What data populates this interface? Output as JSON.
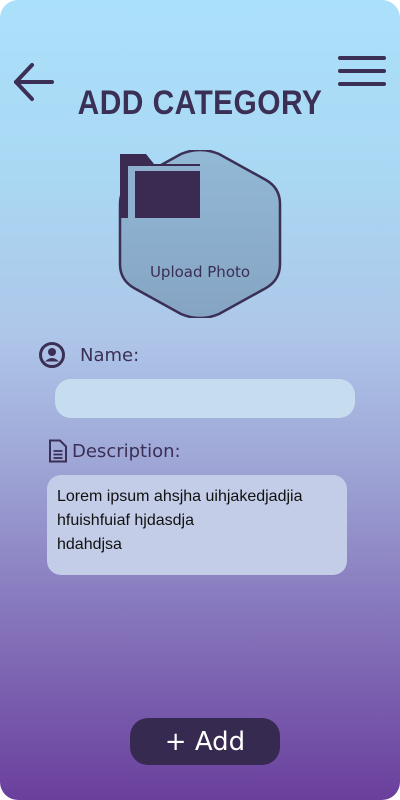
{
  "header": {
    "title": "ADD CATEGORY",
    "back_icon": "arrow-left-icon",
    "menu_icon": "hamburger-menu-icon"
  },
  "upload": {
    "label": "Upload Photo",
    "icon": "folder-icon"
  },
  "form": {
    "name": {
      "label": "Name:",
      "icon": "user-circle-icon",
      "value": "",
      "placeholder": ""
    },
    "description": {
      "label": "Description:",
      "icon": "document-icon",
      "value": "Lorem ipsum ahsjha uihjakedjadjia\nhfuishfuiaf hjdasdja\nhdahdjsa"
    }
  },
  "actions": {
    "add_label": "+ Add"
  },
  "colors": {
    "primary_dark": "#362a50",
    "text_dark": "#3b2f55",
    "gradient_top": "#abe0fb",
    "gradient_bottom": "#6a3f9d",
    "field_bg": "#c6dcef",
    "hexagon_fill": "#89a9c8"
  }
}
